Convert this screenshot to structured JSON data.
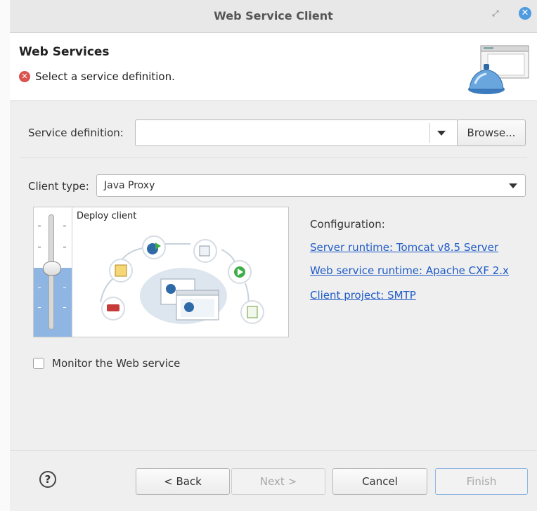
{
  "window": {
    "title": "Web Service Client",
    "restore_glyph": "⤢",
    "close_glyph": "✕"
  },
  "header": {
    "title": "Web Services",
    "error_glyph": "✕",
    "message": "Select a service definition."
  },
  "service_definition": {
    "label": "Service definition:",
    "value": "",
    "browse_button": "Browse..."
  },
  "client_type": {
    "label": "Client type:",
    "value": "Java Proxy"
  },
  "slider": {
    "level_label": "Deploy client",
    "level_fraction": 0.5
  },
  "configuration": {
    "label": "Configuration:",
    "links": [
      "Server runtime: Tomcat v8.5 Server",
      "Web service runtime: Apache CXF 2.x",
      "Client project: SMTP"
    ]
  },
  "monitor": {
    "label": "Monitor the Web service",
    "checked": false
  },
  "footer": {
    "help_glyph": "?",
    "back": "< Back",
    "next": "Next >",
    "cancel": "Cancel",
    "finish": "Finish"
  },
  "colors": {
    "link": "#1f5bc7",
    "error": "#d9534f",
    "slider_fill": "#8fb6e2",
    "close_button": "#4f9be0"
  }
}
